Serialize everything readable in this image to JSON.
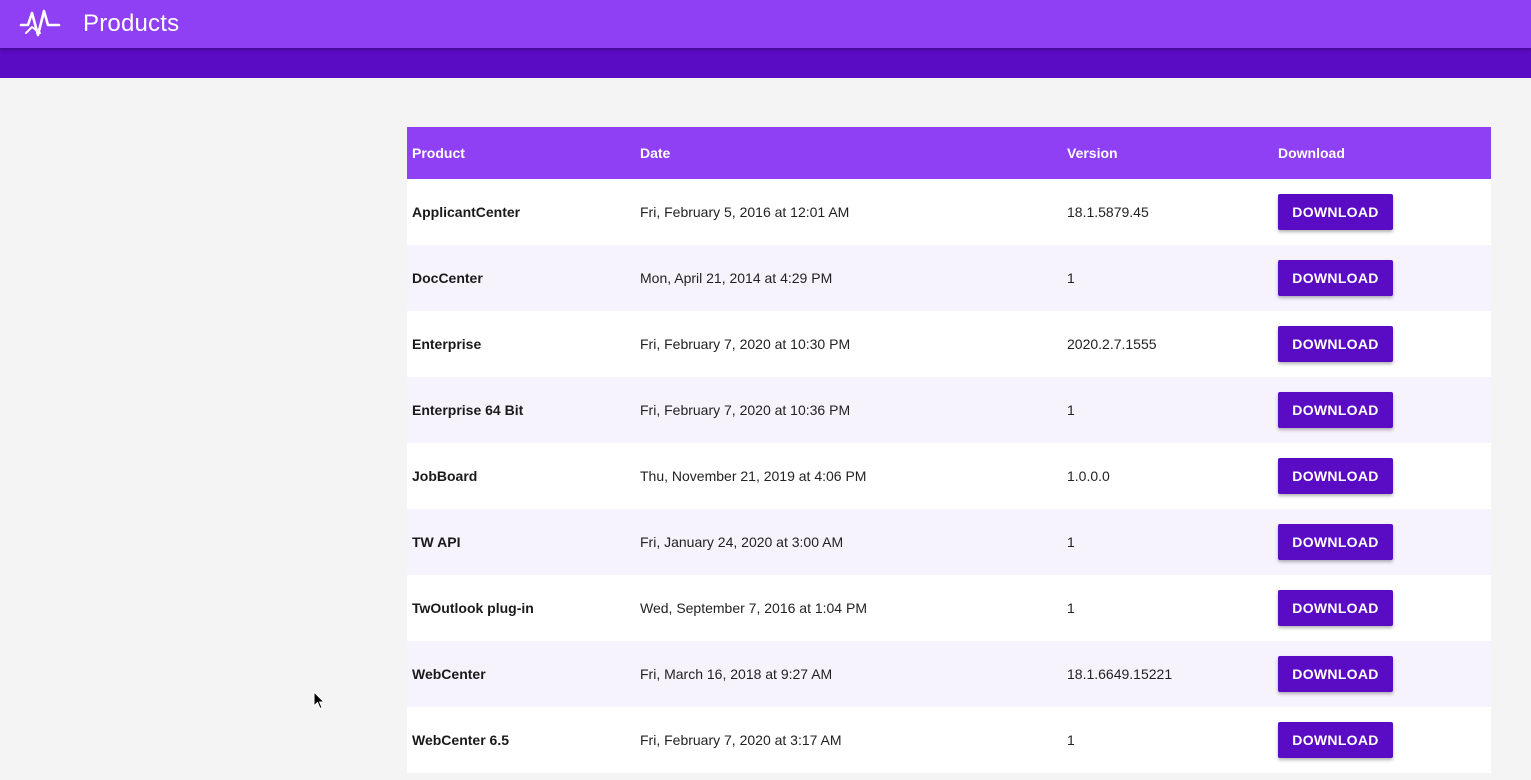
{
  "app": {
    "title": "Products"
  },
  "table": {
    "headers": {
      "product": "Product",
      "date": "Date",
      "version": "Version",
      "download": "Download"
    },
    "rows": [
      {
        "product": "ApplicantCenter",
        "date": "Fri, February 5, 2016 at 12:01 AM",
        "version": "18.1.5879.45",
        "download_label": "DOWNLOAD"
      },
      {
        "product": "DocCenter",
        "date": "Mon, April 21, 2014 at 4:29 PM",
        "version": "1",
        "download_label": "DOWNLOAD"
      },
      {
        "product": "Enterprise",
        "date": "Fri, February 7, 2020 at 10:30 PM",
        "version": "2020.2.7.1555",
        "download_label": "DOWNLOAD"
      },
      {
        "product": "Enterprise 64 Bit",
        "date": "Fri, February 7, 2020 at 10:36 PM",
        "version": "1",
        "download_label": "DOWNLOAD"
      },
      {
        "product": "JobBoard",
        "date": "Thu, November 21, 2019 at 4:06 PM",
        "version": "1.0.0.0",
        "download_label": "DOWNLOAD"
      },
      {
        "product": "TW API",
        "date": "Fri, January 24, 2020 at 3:00 AM",
        "version": "1",
        "download_label": "DOWNLOAD"
      },
      {
        "product": "TwOutlook plug-in",
        "date": "Wed, September 7, 2016 at 1:04 PM",
        "version": "1",
        "download_label": "DOWNLOAD"
      },
      {
        "product": "WebCenter",
        "date": "Fri, March 16, 2018 at 9:27 AM",
        "version": "18.1.6649.15221",
        "download_label": "DOWNLOAD"
      },
      {
        "product": "WebCenter 6.5",
        "date": "Fri, February 7, 2020 at 3:17 AM",
        "version": "1",
        "download_label": "DOWNLOAD"
      }
    ]
  },
  "colors": {
    "appbar": "#8f3ff4",
    "subbar": "#5a0bc4",
    "header": "#8f3ff4",
    "button": "#5a0bc4",
    "background": "#f4f4f4"
  },
  "icons": {
    "logo": "waveform-logo-icon",
    "cursor": "mouse-pointer-icon"
  }
}
